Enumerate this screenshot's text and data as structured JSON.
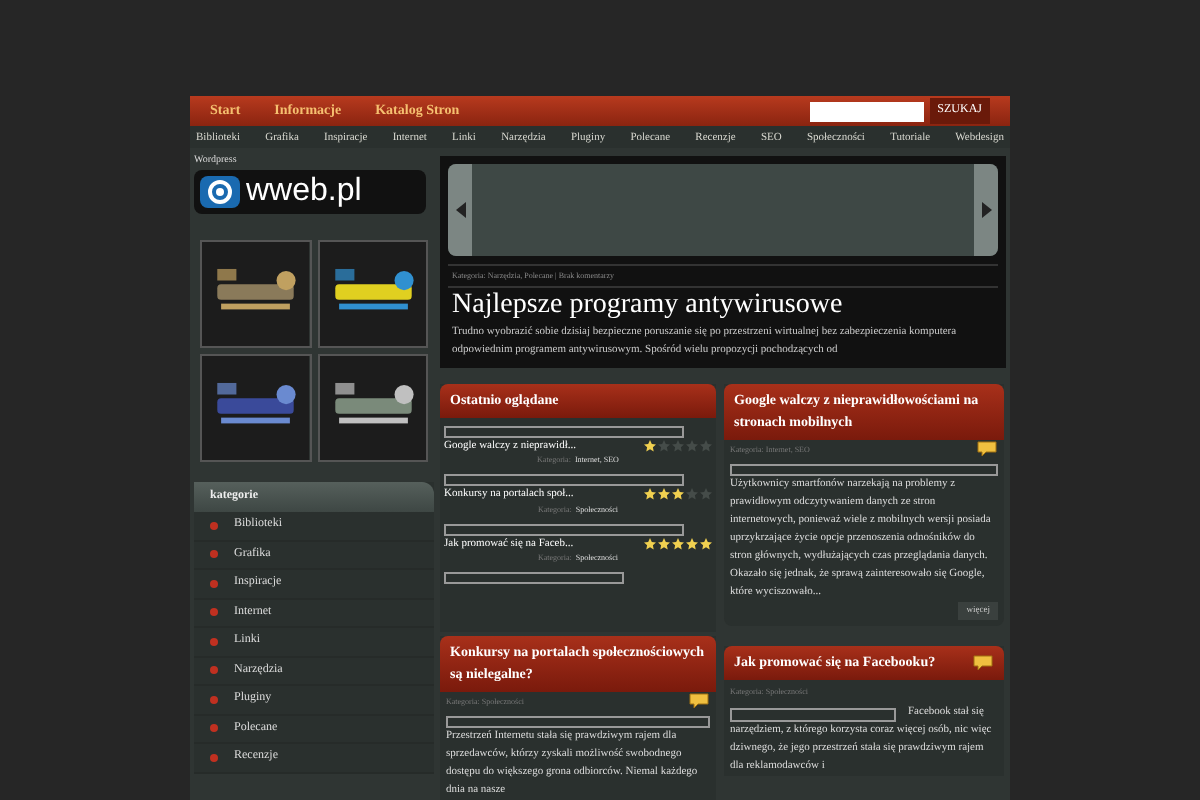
{
  "top_nav": {
    "links": [
      "Start",
      "Informacje",
      "Katalog Stron"
    ],
    "search_button": "SZUKAJ"
  },
  "category_nav": [
    "Biblioteki",
    "Grafika",
    "Inspiracje",
    "Internet",
    "Linki",
    "Narzędzia",
    "Pluginy",
    "Polecane",
    "Recenzje",
    "SEO",
    "Społeczności",
    "Tutoriale",
    "Webdesign"
  ],
  "sidebar": {
    "tag": "Wordpress",
    "logo": "wweb.pl",
    "categories_title": "kategorie",
    "categories": [
      "Biblioteki",
      "Grafika",
      "Inspiracje",
      "Internet",
      "Linki",
      "Narzędzia",
      "Pluginy",
      "Polecane",
      "Recenzje"
    ]
  },
  "featured": {
    "meta": "Kategoria: Narzędzia, Polecane | Brak komentarzy",
    "title": "Najlepsze programy antywirusowe",
    "excerpt": "Trudno wyobrazić sobie dzisiaj bezpieczne poruszanie się po przestrzeni wirtualnej bez zabezpieczenia komputera odpowiednim programem antywirusowym. Spośród wielu propozycji pochodzących od"
  },
  "recent": {
    "title": "Ostatnio oglądane",
    "items": [
      {
        "title": "Google walczy z nieprawidł...",
        "stars": 1,
        "label": "Kategoria:",
        "categories": "Internet, SEO"
      },
      {
        "title": "Konkursy na portalach społ...",
        "stars": 3,
        "label": "Kategoria:",
        "categories": "Społeczności"
      },
      {
        "title": "Jak promować się na Faceb...",
        "stars": 5,
        "label": "Kategoria:",
        "categories": "Społeczności"
      }
    ]
  },
  "posts": [
    {
      "title": "Google walczy z nieprawidłowościami na stronach mobilnych",
      "meta": "Kategoria: Internet, SEO",
      "excerpt": "Użytkownicy smartfonów narzekają na problemy z prawidłowym odczytywaniem danych ze stron internetowych, ponieważ wiele z mobilnych wersji posiada uprzykrzające życie opcje przenoszenia odnośników do stron głównych, wydłużających czas przeglądania danych. Okazało się jednak, że sprawą zainteresowało się Google, które wyciszowało...",
      "more": "więcej"
    },
    {
      "title": "Konkursy na portalach społecznościowych są nielegalne?",
      "meta": "Kategoria: Społeczności",
      "excerpt": "Przestrzeń Internetu stała się prawdziwym rajem dla sprzedawców, którzy zyskali możliwość swobodnego dostępu do większego grona odbiorców. Niemal każdego dnia na nasze"
    },
    {
      "title": "Jak promować się na Facebooku?",
      "meta": "Kategoria: Społeczności",
      "excerpt_lead": "Facebook stał się",
      "excerpt": "narzędziem, z którego korzysta coraz więcej osób, nic więc dziwnego, że jego przestrzeń stała się prawdziwym rajem dla reklamodawców i"
    }
  ]
}
